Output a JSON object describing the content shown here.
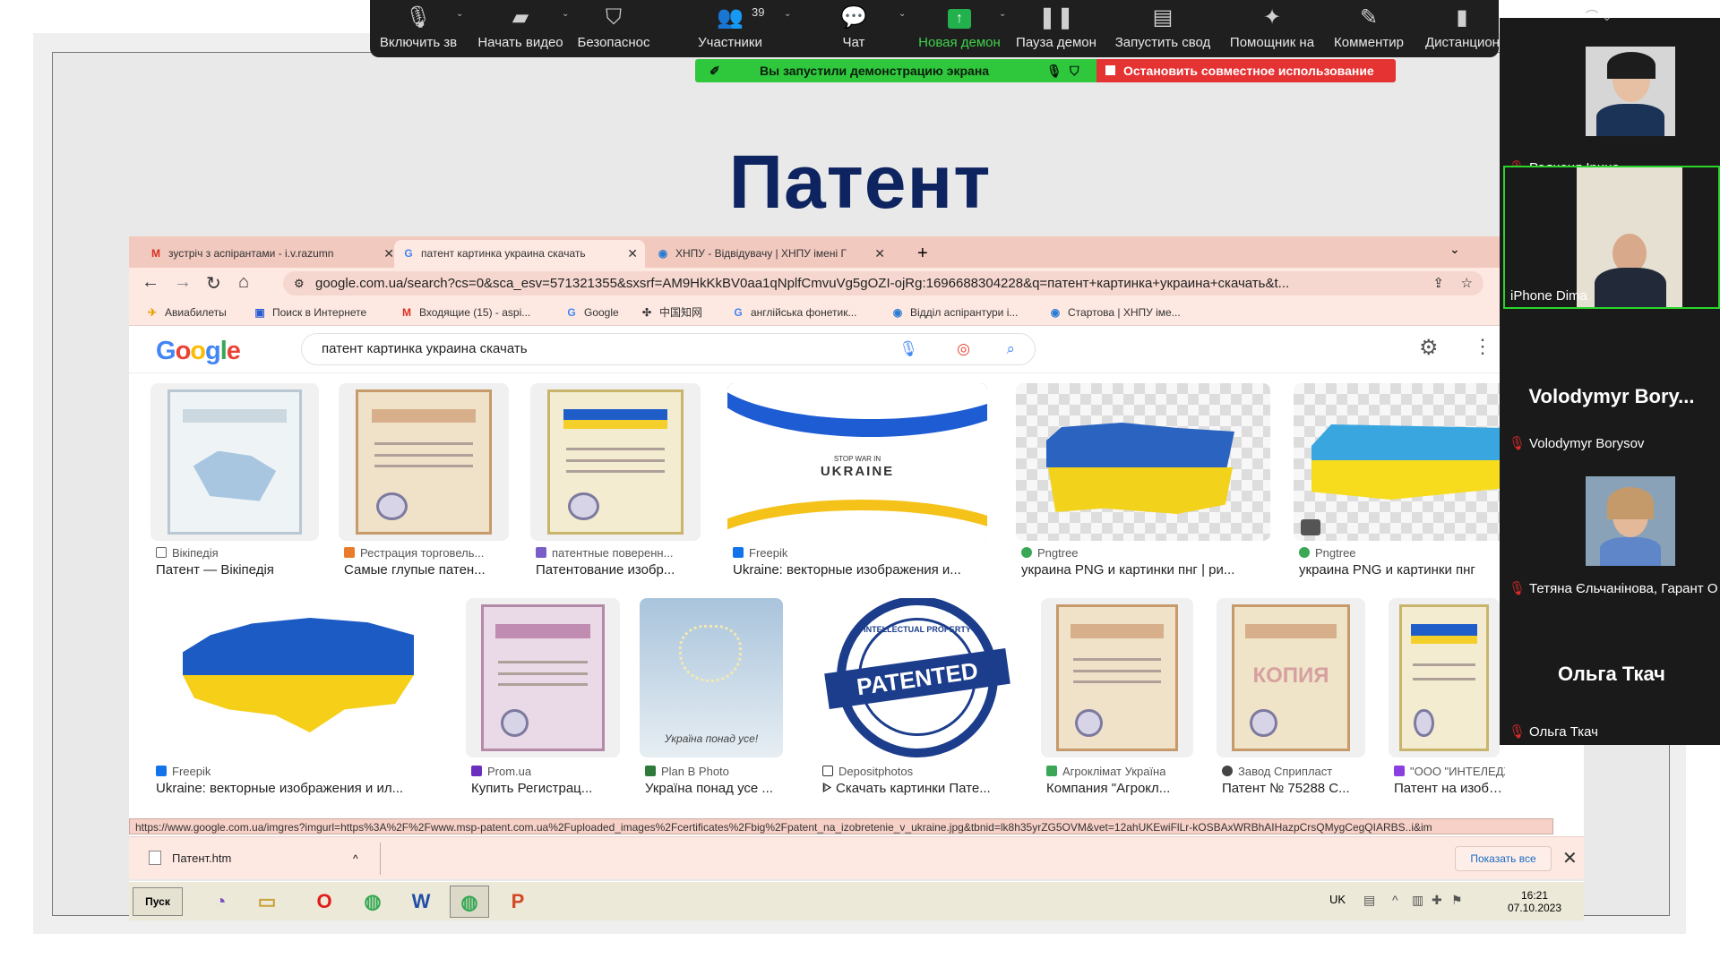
{
  "slide": {
    "title": "Патент"
  },
  "zoom_toolbar": {
    "participant_count": "39",
    "items": [
      {
        "label": "Включить зв",
        "icon": "mic-off-icon"
      },
      {
        "label": "Начать видео",
        "icon": "video-off-icon"
      },
      {
        "label": "Безопаснос",
        "icon": "shield-icon"
      },
      {
        "label": "Участники",
        "icon": "participants-icon"
      },
      {
        "label": "Чат",
        "icon": "chat-icon"
      },
      {
        "label": "Новая демон",
        "icon": "share-screen-icon"
      },
      {
        "label": "Пауза демон",
        "icon": "pause-icon"
      },
      {
        "label": "Запустить свод",
        "icon": "summary-icon"
      },
      {
        "label": "Помощник на",
        "icon": "sparkle-icon"
      },
      {
        "label": "Комментир",
        "icon": "pen-icon"
      },
      {
        "label": "Дистанцион",
        "icon": "mouse-icon"
      }
    ]
  },
  "share_banner": {
    "text": "Вы запустили демонстрацию экрана",
    "stop_label": "Остановить совместное использование",
    "color": "#2fc83d",
    "stop_color": "#e53232"
  },
  "browser": {
    "tabs": [
      {
        "title": "зустріч з аспірантами - i.v.razumn",
        "icon": "gmail-icon"
      },
      {
        "title": "патент картинка украина скачать",
        "icon": "google-icon"
      },
      {
        "title": "ХНПУ - Відвідувачу | ХНПУ імені Г",
        "icon": "globe-icon"
      }
    ],
    "url": "google.com.ua/search?cs=0&sca_esv=571321355&sxsrf=AM9HkKkBV0aa1qNplfCmvuVg5gOZI-ojRg:1696688304228&q=патент+картинка+украина+скачать&t...",
    "bookmarks": [
      {
        "label": "Авиабилеты"
      },
      {
        "label": "Поиск в Интернете"
      },
      {
        "label": "Входящие (15) - aspi..."
      },
      {
        "label": "Google"
      },
      {
        "label": "中国知网"
      },
      {
        "label": "англійська фонетик..."
      },
      {
        "label": "Відділ аспірантури і..."
      },
      {
        "label": "Стартова | ХНПУ іме..."
      }
    ],
    "search_query": "патент картинка украина скачать",
    "logo": [
      "G",
      "o",
      "o",
      "g",
      "l",
      "e"
    ],
    "results_row1": [
      {
        "source": "Вікіпедія",
        "title": "Патент — Вікіпедія"
      },
      {
        "source": "Рестрация торговель...",
        "title": "Самые глупые патен..."
      },
      {
        "source": "патентные поверенн...",
        "title": "Патентование изобр..."
      },
      {
        "source": "Freepik",
        "title": "Ukraine: векторные изображения и...",
        "image_text": "STOP WAR IN",
        "image_text2": "UKRAINE"
      },
      {
        "source": "Pngtree",
        "title": "украина PNG и картинки пнг | ри..."
      },
      {
        "source": "Pngtree",
        "title": "украина PNG и картинки пнг"
      }
    ],
    "results_row2": [
      {
        "source": "Freepik",
        "title": "Ukraine: векторные изображения и ил..."
      },
      {
        "source": "Prom.ua",
        "title": "Купить Регистрац..."
      },
      {
        "source": "Plan B Photo",
        "title": "Україна понад усе ...",
        "image_text": "Україна понад усе!"
      },
      {
        "source": "Depositphotos",
        "title": "ᐈ Скачать картинки Пате...",
        "image_text": "PATENTED",
        "ring_text": "INTELLECTUAL PROPERTY"
      },
      {
        "source": "Агроклімат Україна",
        "title": "Компания \"Агрокл..."
      },
      {
        "source": "Завод Сприпласт",
        "title": "Патент № 75288 С..."
      },
      {
        "source": "\"ООО \"ИНТЕЛЕДЖ...",
        "title": "Патент на изобрет..."
      }
    ],
    "status_url": "https://www.google.com.ua/imgres?imgurl=https%3A%2F%2Fwww.msp-patent.com.ua%2Fuploaded_images%2Fcertificates%2Fbig%2Fpatent_na_izobretenie_v_ukraine.jpg&tbnid=lk8h35yrZG5OVM&vet=12ahUKEwiFlLr-kOSBAxWRBhAIHazpCrsQMygCegQIARBS..i&im",
    "download": {
      "file": "Патент.htm",
      "show_all": "Показать все"
    }
  },
  "taskbar": {
    "start_label": "Пуск",
    "lang": "UK",
    "time": "16:21",
    "date": "07.10.2023"
  },
  "participants": [
    {
      "name": "Радченя Ірина",
      "muted": true,
      "video": true
    },
    {
      "name": "iPhone Dima",
      "muted": false,
      "video": true
    },
    {
      "name": "Volodymyr Borysov",
      "muted": true,
      "video": false,
      "display": "Volodymyr Bory..."
    },
    {
      "name": "Тетяна Єльчанінова, Гарант О",
      "muted": true,
      "video": true
    },
    {
      "name": "Ольга Ткач",
      "muted": true,
      "video": false,
      "display": "Ольга Ткач"
    }
  ]
}
